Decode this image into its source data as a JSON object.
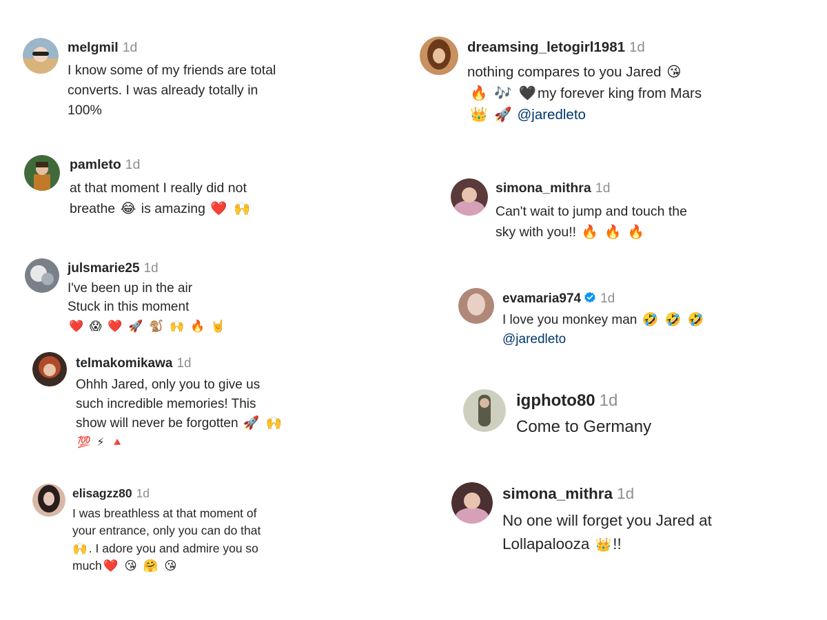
{
  "comments": [
    {
      "username": "melgmil",
      "time": "1d",
      "lines": [
        "I know some of my friends are total",
        "converts. I was already totally in",
        "100%"
      ],
      "avatar": {
        "icon": "avatar-photo-icon",
        "colors": [
          "#9bb6c8",
          "#d9b37c"
        ]
      }
    },
    {
      "username": "pamleto",
      "time": "1d",
      "lines": [
        "at that moment I really did not"
      ],
      "line2": {
        "a": "breathe",
        "e1": "😂",
        "b": "is amazing",
        "e2": "❤️",
        "e3": "🙌"
      },
      "avatar": {
        "icon": "avatar-photo-icon",
        "colors": [
          "#3f6b3a",
          "#c07a2a"
        ]
      }
    },
    {
      "username": "julsmarie25",
      "time": "1d",
      "lines": [
        "I've been up in the air",
        "Stuck in this moment"
      ],
      "emojis": [
        "❤️",
        "😱",
        "❤️",
        "🚀",
        "🐒",
        "🙌",
        "🔥",
        "🤘"
      ],
      "avatar": {
        "icon": "avatar-photo-icon",
        "colors": [
          "#7a8088",
          "#e8e8e8"
        ]
      }
    },
    {
      "username": "telmakomikawa",
      "time": "1d",
      "lines": [
        "Ohhh Jared, only you to give us",
        "such incredible memories! This"
      ],
      "line3": {
        "a": "show will never be forgotten",
        "e1": "🚀",
        "e2": "🙌"
      },
      "emojis": [
        "💯",
        "⚡",
        "🔺"
      ],
      "avatar": {
        "icon": "avatar-photo-icon",
        "colors": [
          "#b04a2a",
          "#3a2a22"
        ]
      }
    },
    {
      "username": "elisagzz80",
      "time": "1d",
      "lines": [
        "I was breathless at that moment of",
        "your entrance, only you can do that"
      ],
      "line3": {
        "e1": "🙌",
        "a": ". I adore you and admire you so"
      },
      "line4": {
        "a": "much",
        "e1": "❤️",
        "e2": "😘",
        "e3": "🤗",
        "e4": "😘"
      },
      "avatar": {
        "icon": "avatar-photo-icon",
        "colors": [
          "#2a1e1c",
          "#d8b8a8"
        ]
      }
    },
    {
      "username": "dreamsing_letogirl1981",
      "time": "1d",
      "line1": {
        "a": "nothing compares to you Jared",
        "e1": "😘"
      },
      "line2": {
        "e1": "🔥",
        "e2": "🎶",
        "e3": "🖤",
        "a": "my forever king from Mars"
      },
      "line3": {
        "e1": "👑",
        "e2": "🚀",
        "mention": "@jaredleto"
      },
      "avatar": {
        "icon": "avatar-photo-icon",
        "colors": [
          "#6a3a1a",
          "#c99060"
        ]
      }
    },
    {
      "username": "simona_mithra",
      "time": "1d",
      "lines": [
        "Can't wait to jump and touch the"
      ],
      "line2": {
        "a": "sky with you!!",
        "e1": "🔥",
        "e2": "🔥",
        "e3": "🔥"
      },
      "avatar": {
        "icon": "avatar-photo-icon",
        "colors": [
          "#5a3a3a",
          "#d6a0b8"
        ]
      }
    },
    {
      "username": "evamaria974",
      "time": "1d",
      "line1": {
        "a": "I love you monkey man",
        "e1": "🤣",
        "e2": "🤣",
        "e3": "🤣"
      },
      "mention": "@jaredleto",
      "verified_icon": "verified-badge-icon",
      "avatar": {
        "icon": "avatar-photo-icon",
        "colors": [
          "#b08878",
          "#e8d0c4"
        ]
      }
    },
    {
      "username": "igphoto80",
      "time": "1d",
      "lines": [
        "Come to Germany"
      ],
      "avatar": {
        "icon": "avatar-photo-icon",
        "colors": [
          "#5a5a4a",
          "#cfcfc0"
        ]
      }
    },
    {
      "username": "simona_mithra",
      "time": "1d",
      "lines": [
        "No one will forget you Jared at"
      ],
      "line2": {
        "a": "Lollapalooza",
        "e1": "👑",
        "b": "!!"
      },
      "avatar": {
        "icon": "avatar-photo-icon",
        "colors": [
          "#4a3030",
          "#d6a0b8"
        ]
      }
    }
  ],
  "colors": {
    "username": "#262626",
    "time": "#8e8e8e",
    "mention": "#00376b",
    "verified": "#0095f6"
  }
}
